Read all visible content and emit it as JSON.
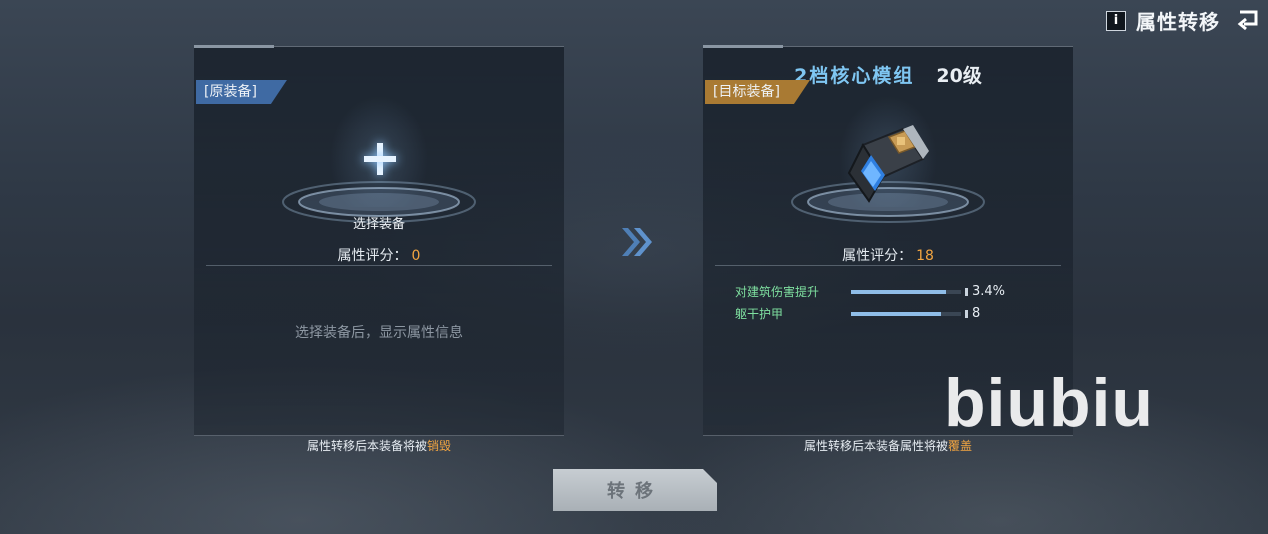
{
  "header": {
    "info_icon": "i",
    "title": "属性转移",
    "back_icon": "↵"
  },
  "left_panel": {
    "tag": "[原装备]",
    "select_label": "选择装备",
    "score_label": "属性评分：",
    "score_value": "0",
    "hint": "选择装备后，显示属性信息",
    "footnote_prefix": "属性转移后本装备将被",
    "footnote_warn": "销毁"
  },
  "right_panel": {
    "item_name": "2档核心模组",
    "item_level": "20级",
    "tag": "[目标装备]",
    "score_label": "属性评分：",
    "score_value": "18",
    "attributes": [
      {
        "name": "对建筑伤害提升",
        "value": "3.4%",
        "fill": 0.86
      },
      {
        "name": "躯干护甲",
        "value": "8",
        "fill": 0.82
      }
    ],
    "footnote_prefix": "属性转移后本装备属性将被",
    "footnote_warn": "覆盖"
  },
  "action": {
    "transfer_label": "转移"
  },
  "watermark": "biubiu",
  "colors": {
    "accent_orange": "#f2a541",
    "tag_blue": "#3f6aa3",
    "tag_gold": "#a97a33",
    "item_name": "#7fc6f2",
    "attr_green": "#7fe0a0"
  }
}
